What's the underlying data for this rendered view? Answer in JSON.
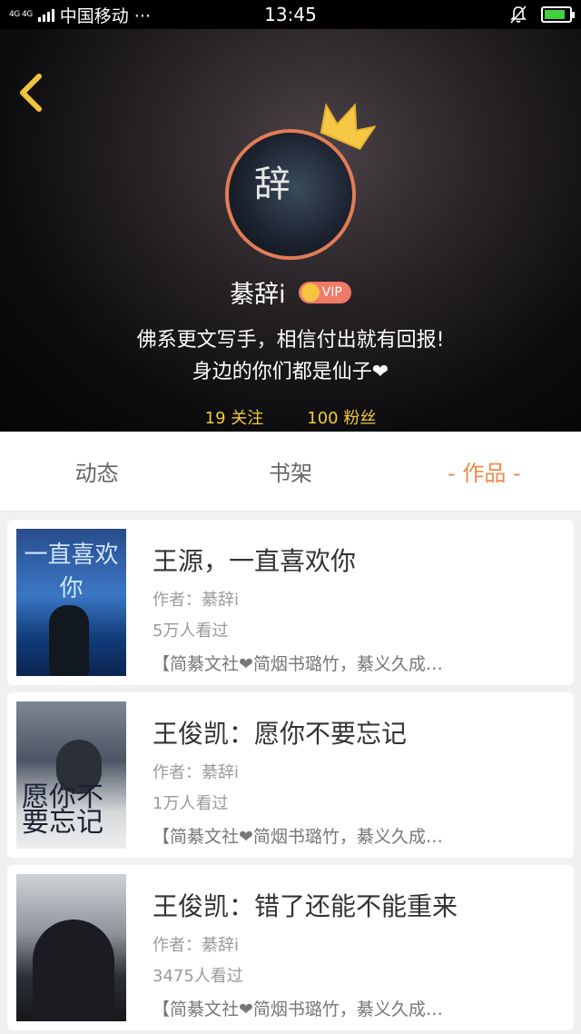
{
  "status_bar": {
    "network": "4G 4G",
    "carrier": "中国移动 ···",
    "time": "13:45",
    "battery_level": 0.85
  },
  "profile": {
    "avatar_text": "辞",
    "name": "綦辞i",
    "vip_label": "VIP",
    "bio_line_1": "佛系更文写手，相信付出就有回报!",
    "bio_line_2": "身边的你们都是仙子❤",
    "following": "19 关注",
    "followers": "100 粉丝"
  },
  "tabs": [
    {
      "label": "动态",
      "active": false
    },
    {
      "label": "书架",
      "active": false
    },
    {
      "label": "- 作品 -",
      "active": true
    }
  ],
  "works": [
    {
      "cover_text": "一直喜欢你",
      "title": "王源，一直喜欢你",
      "author": "作者：綦辞i",
      "views": "5万人看过",
      "tags": "【简綦文社❤简烟书璐竹，綦义久成…"
    },
    {
      "cover_text": "愿你不要忘记",
      "title": "王俊凯：愿你不要忘记",
      "author": "作者：綦辞i",
      "views": "1万人看过",
      "tags": "【简綦文社❤简烟书璐竹，綦义久成…"
    },
    {
      "cover_text": "",
      "title": "王俊凯：错了还能不能重来",
      "author": "作者：綦辞i",
      "views": "3475人看过",
      "tags": "【简綦文社❤简烟书璐竹，綦义久成…"
    }
  ],
  "colors": {
    "accent": "#f1884a",
    "stats": "#f1cd33",
    "back": "#f0c43a",
    "avatar_border": "#e27d56",
    "vip": "#f07a68"
  }
}
